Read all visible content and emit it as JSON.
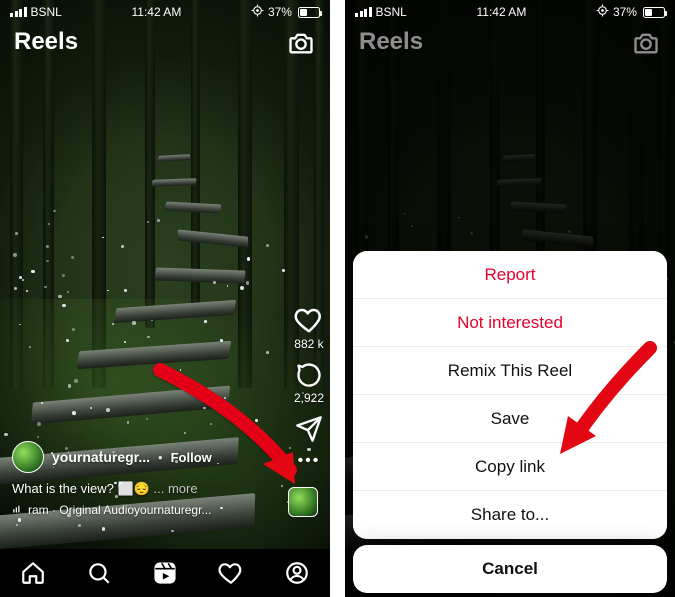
{
  "status": {
    "carrier": "BSNL",
    "time": "11:42 AM",
    "battery_pct": "37%"
  },
  "header": {
    "title": "Reels"
  },
  "reel": {
    "username": "yournaturegr...",
    "follow_label": "Follow",
    "caption_text": "What is the view?",
    "caption_emoji": "⬜😔",
    "more_label": "... more",
    "audio_text": "ram · Original Audioyournaturegr...",
    "like_count": "882 k",
    "comment_count": "2,922"
  },
  "sheet": {
    "report": "Report",
    "not_interested": "Not interested",
    "remix": "Remix This Reel",
    "save": "Save",
    "copy_link": "Copy link",
    "share_to": "Share to...",
    "cancel": "Cancel"
  }
}
